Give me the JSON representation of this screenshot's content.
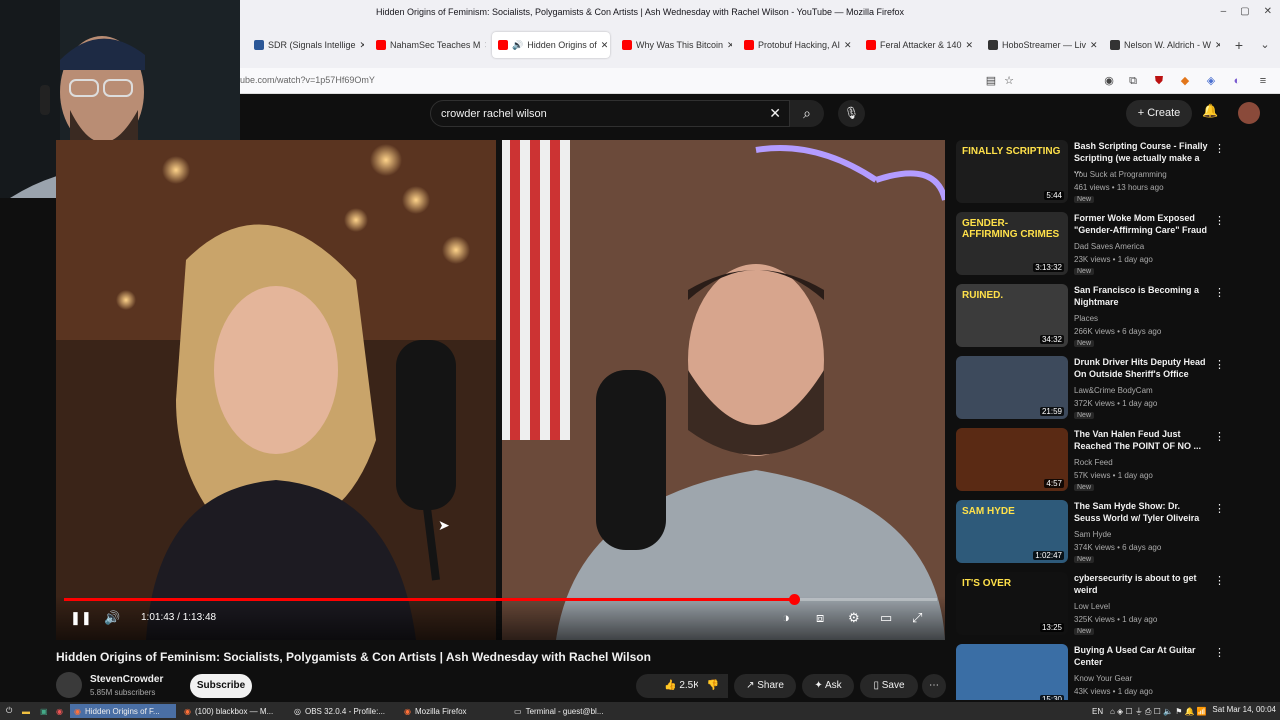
{
  "window": {
    "title": "Hidden Origins of Feminism: Socialists, Polygamists & Con Artists | Ash Wednesday with Rachel Wilson - YouTube — Mozilla Firefox"
  },
  "tabs": [
    {
      "label": "SDR (Signals Intellige",
      "color": "#2b5797"
    },
    {
      "label": "NahamSec Teaches M",
      "color": "#ff0000"
    },
    {
      "label": "Hidden Origins of",
      "color": "#ff0000"
    },
    {
      "label": "Why Was This Bitcoin",
      "color": "#ff0000"
    },
    {
      "label": "Protobuf Hacking, AI",
      "color": "#ff0000"
    },
    {
      "label": "Feral Attacker & 140",
      "color": "#ff0000"
    },
    {
      "label": "HoboStreamer — Liv",
      "color": "#333333"
    },
    {
      "label": "Nelson W. Aldrich - W",
      "color": "#333333"
    }
  ],
  "url": "ube.com/watch?v=1p57Hf69OmY",
  "search": {
    "query": "crowder rachel wilson"
  },
  "header": {
    "create_label": "Create"
  },
  "player": {
    "time": "1:01:43 / 1:13:48",
    "progress": 0.836
  },
  "video": {
    "title": "Hidden Origins of Feminism: Socialists, Polygamists & Con Artists | Ash Wednesday with Rachel Wilson",
    "channel": "StevenCrowder",
    "subscribers": "5.85M subscribers",
    "subscribe_label": "Subscribe",
    "likes": "2.5K",
    "share_label": "Share",
    "ask_label": "Ask",
    "save_label": "Save"
  },
  "related": [
    {
      "title": "Bash Scripting Course - Finally Scripting (we actually make a ...",
      "channel": "You Suck at Programming",
      "meta": "461 views • 13 hours ago",
      "badge": "New",
      "duration": "5:44",
      "thumb_text": "FINALLY SCRIPTING",
      "thumb_color": "#1c1c1c"
    },
    {
      "title": "Former Woke Mom Exposed \"Gender-Affirming Care\" Fraud",
      "channel": "Dad Saves America",
      "meta": "23K views • 1 day ago",
      "badge": "New",
      "duration": "3:13:32",
      "thumb_text": "GENDER-AFFIRMING CRIMES",
      "thumb_color": "#2a2a2a"
    },
    {
      "title": "San Francisco is Becoming a Nightmare",
      "channel": "Places",
      "meta": "266K views • 6 days ago",
      "badge": "New",
      "duration": "34:32",
      "thumb_text": "RUINED.",
      "thumb_color": "#3b3b3b"
    },
    {
      "title": "Drunk Driver Hits Deputy Head On Outside Sheriff's Office",
      "channel": "Law&Crime BodyCam",
      "meta": "372K views • 1 day ago",
      "badge": "New",
      "duration": "21:59",
      "thumb_text": "",
      "thumb_color": "#3d4a5c"
    },
    {
      "title": "The Van Halen Feud Just Reached The POINT OF NO ...",
      "channel": "Rock Feed",
      "meta": "57K views • 1 day ago",
      "badge": "New",
      "duration": "4:57",
      "thumb_text": "",
      "thumb_color": "#5a2a14"
    },
    {
      "title": "The Sam Hyde Show: Dr. Seuss World w/ Tyler Oliveira",
      "channel": "Sam Hyde",
      "meta": "374K views • 6 days ago",
      "badge": "New",
      "duration": "1:02:47",
      "thumb_text": "SAM HYDE",
      "thumb_color": "#2e5a7a"
    },
    {
      "title": "cybersecurity is about to get weird",
      "channel": "Low Level",
      "meta": "325K views • 1 day ago",
      "badge": "New",
      "duration": "13:25",
      "thumb_text": "IT'S OVER",
      "thumb_color": "#111111"
    },
    {
      "title": "Buying A Used Car At Guitar Center",
      "channel": "Know Your Gear",
      "meta": "43K views • 1 day ago",
      "badge": "",
      "duration": "15:30",
      "thumb_text": "",
      "thumb_color": "#3a6ea5"
    }
  ],
  "taskbar": {
    "items": [
      "Hidden Origins of F...",
      "(100) blackbox — M...",
      "OBS 32.0.4 - Profile:...",
      "Mozilla Firefox",
      "Terminal - guest@bl..."
    ],
    "lang": "EN",
    "clock": "Sat Mar 14, 00:04"
  }
}
